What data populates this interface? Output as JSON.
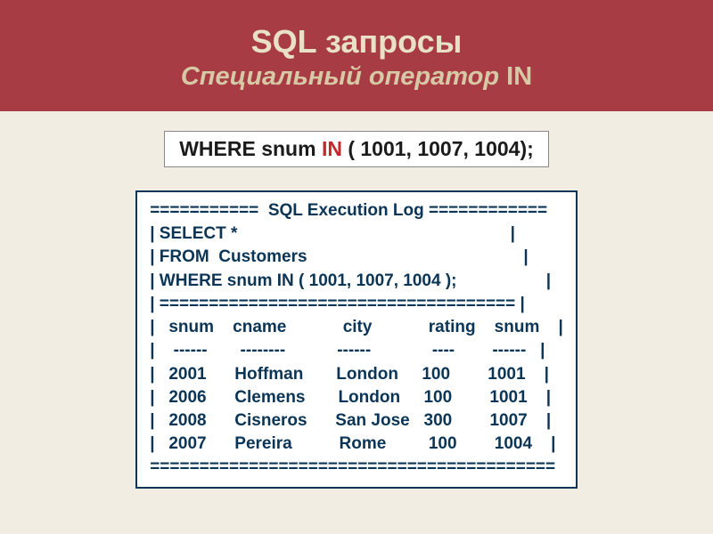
{
  "header": {
    "title_main": "SQL запросы",
    "title_sub_italic": "Специальный оператор ",
    "title_sub_op": "IN"
  },
  "clause": {
    "prefix": "WHERE snum ",
    "keyword": "IN",
    "suffix": " ( 1001, 1007, 1004);"
  },
  "log": {
    "line1": "===========  SQL Execution Log ============",
    "line2": "| SELECT *                                                          |",
    "line3": "| FROM  Customers                                              |",
    "line4": "| WHERE snum IN ( 1001, 1007, 1004 );                   |",
    "line5": "| ==================================== |",
    "line6": "|   snum    cname            city            rating    snum    |",
    "line7": "|    ------       --------           ------             ----        ------   |",
    "line8": "|   2001      Hoffman       London     100        1001    |",
    "line9": "|   2006      Clemens       London     100        1001    |",
    "line10": "|   2008      Cisneros      San Jose   300        1007    |",
    "line11": "|   2007      Pereira          Rome         100        1004    |",
    "line12": "========================================="
  },
  "chart_data": {
    "type": "table",
    "title": "SQL Execution Log",
    "query": "SELECT * FROM Customers WHERE snum IN ( 1001, 1007, 1004 );",
    "columns": [
      "snum",
      "cname",
      "city",
      "rating",
      "snum"
    ],
    "rows": [
      [
        2001,
        "Hoffman",
        "London",
        100,
        1001
      ],
      [
        2006,
        "Clemens",
        "London",
        100,
        1001
      ],
      [
        2008,
        "Cisneros",
        "San Jose",
        300,
        1007
      ],
      [
        2007,
        "Pereira",
        "Rome",
        100,
        1004
      ]
    ]
  }
}
